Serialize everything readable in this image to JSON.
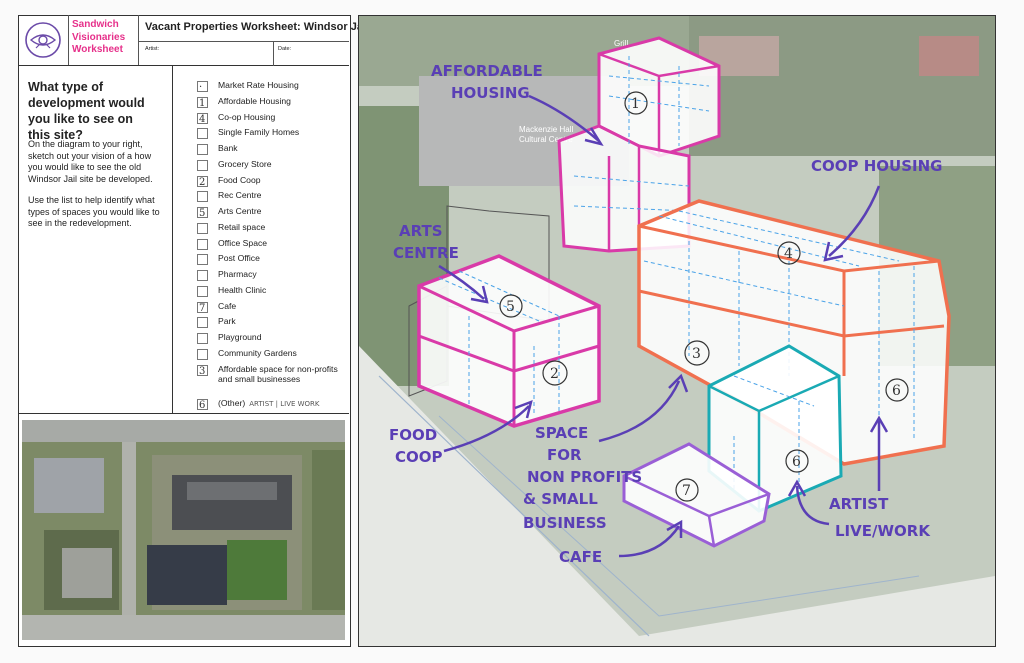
{
  "brand": {
    "name_line1": "Sandwich",
    "name_line2": "Visionaries",
    "name_line3": "Worksheet"
  },
  "worksheet": {
    "title": "Vacant Properties Worksheet: Windsor Jail",
    "artist_label": "Artist:",
    "date_label": "Date:"
  },
  "prompt": {
    "question": "What type of development would you like to see on this site?",
    "instruction_1": "On the diagram to your right, sketch out your vision of a how you would like to see the old Windsor Jail site be developed.",
    "instruction_2": "Use the list to help identify what types of spaces you would like to see in the redevelopment."
  },
  "checklist": [
    {
      "label": "Market Rate Housing",
      "mark": "·"
    },
    {
      "label": "Affordable Housing",
      "mark": "1"
    },
    {
      "label": "Co-op Housing",
      "mark": "4"
    },
    {
      "label": "Single Family Homes",
      "mark": ""
    },
    {
      "label": "Bank",
      "mark": ""
    },
    {
      "label": "Grocery Store",
      "mark": ""
    },
    {
      "label": "Food Coop",
      "mark": "2"
    },
    {
      "label": "Rec Centre",
      "mark": ""
    },
    {
      "label": "Arts Centre",
      "mark": "5"
    },
    {
      "label": "Retail space",
      "mark": ""
    },
    {
      "label": "Office Space",
      "mark": ""
    },
    {
      "label": "Post Office",
      "mark": ""
    },
    {
      "label": "Pharmacy",
      "mark": ""
    },
    {
      "label": "Health Clinic",
      "mark": ""
    },
    {
      "label": "Cafe",
      "mark": "7"
    },
    {
      "label": "Park",
      "mark": ""
    },
    {
      "label": "Playground",
      "mark": ""
    },
    {
      "label": "Community Gardens",
      "mark": ""
    },
    {
      "label": "Affordable space for non-profits and small businesses",
      "mark": "3"
    },
    {
      "label": "(Other)",
      "mark": "6",
      "written": "ARTIST | LIVE WORK"
    }
  ],
  "diagram": {
    "annotations": {
      "affordable_1": "AFFORDABLE",
      "affordable_2": "HOUSING",
      "coop": "COOP HOUSING",
      "arts_1": "ARTS",
      "arts_2": "CENTRE",
      "food_1": "FOOD",
      "food_2": "COOP",
      "space_1": "SPACE",
      "space_2": "FOR",
      "space_3": "NON PROFITS",
      "space_4": "& SMALL",
      "space_5": "BUSINESS",
      "cafe": "CAFE",
      "artist_1": "ARTIST",
      "artist_2": "LIVE/WORK"
    },
    "numbers": [
      "1",
      "4",
      "5",
      "3",
      "2",
      "6",
      "6",
      "7"
    ],
    "map_labels": {
      "grill": "Grill",
      "hall_1": "Mackenzie Hall",
      "hall_2": "Cultural Centre"
    },
    "colors": {
      "magenta": "#d93aa8",
      "orange": "#f0704f",
      "teal": "#1aaab4",
      "purple": "#9a5fd6",
      "pen": "#5a3fb5",
      "grid": "#4aa3e8"
    }
  }
}
